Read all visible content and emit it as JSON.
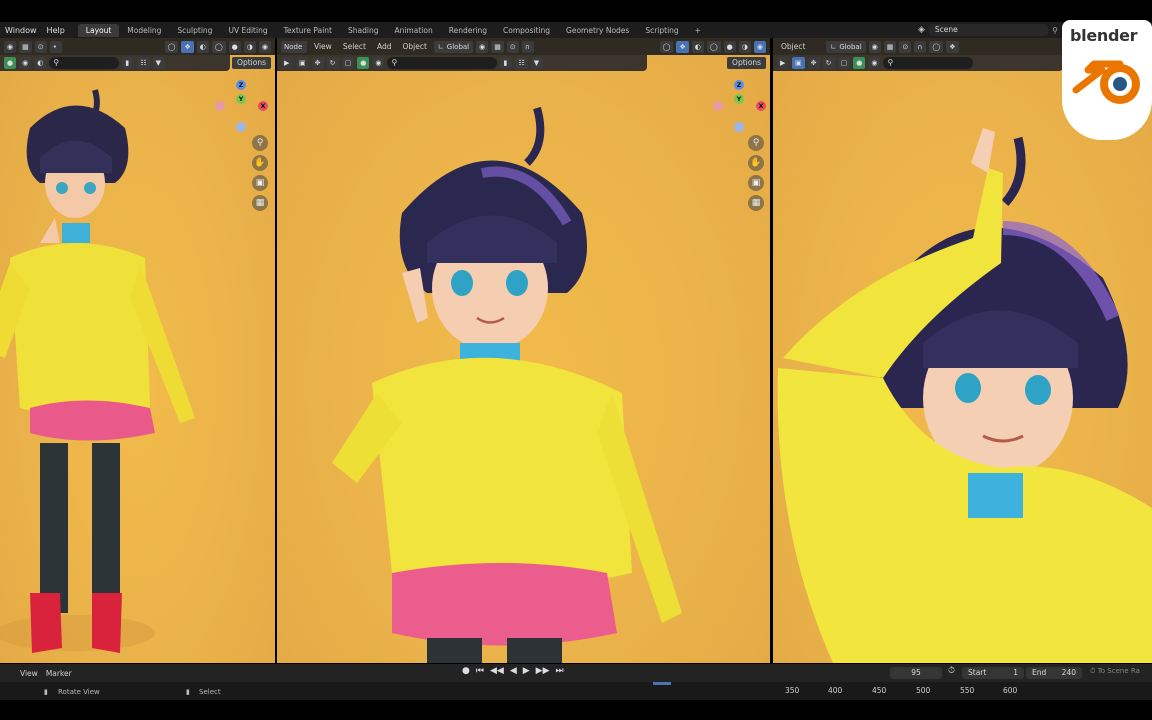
{
  "topbar": {
    "menus": [
      "Window",
      "Help"
    ],
    "workspaces": [
      "Layout",
      "Modeling",
      "Sculpting",
      "UV Editing",
      "Texture Paint",
      "Shading",
      "Animation",
      "Rendering",
      "Compositing",
      "Geometry Nodes",
      "Scripting"
    ],
    "active_workspace": "Layout",
    "add_tab": "+",
    "scene_label": "Scene"
  },
  "viewports": {
    "left": {
      "options": "Options"
    },
    "middle": {
      "mode": "Node",
      "menus": [
        "View",
        "Select",
        "Add",
        "Object"
      ],
      "orientation": "Global",
      "options": "Options"
    },
    "right": {
      "mode": "Object",
      "orientation": "Global"
    }
  },
  "gizmo": {
    "z": "Z",
    "y": "Y",
    "x": "X"
  },
  "timeline": {
    "menus": [
      "View",
      "Marker"
    ],
    "current_frame": "95",
    "start_label": "Start",
    "start_value": "1",
    "end_label": "End",
    "end_value": "240",
    "to_scene": "To Scene Ra"
  },
  "ruler_ticks": [
    "350",
    "400",
    "450",
    "500",
    "550",
    "600"
  ],
  "status": {
    "rotate": "Rotate View",
    "select": "Select"
  },
  "logo": {
    "text": "blender"
  },
  "colors": {
    "viewport_bg": "#eab24a",
    "ui_dark": "#1d1d1d",
    "accent_blue": "#4772b3",
    "logo_orange": "#ea7600",
    "logo_blue": "#265787"
  }
}
